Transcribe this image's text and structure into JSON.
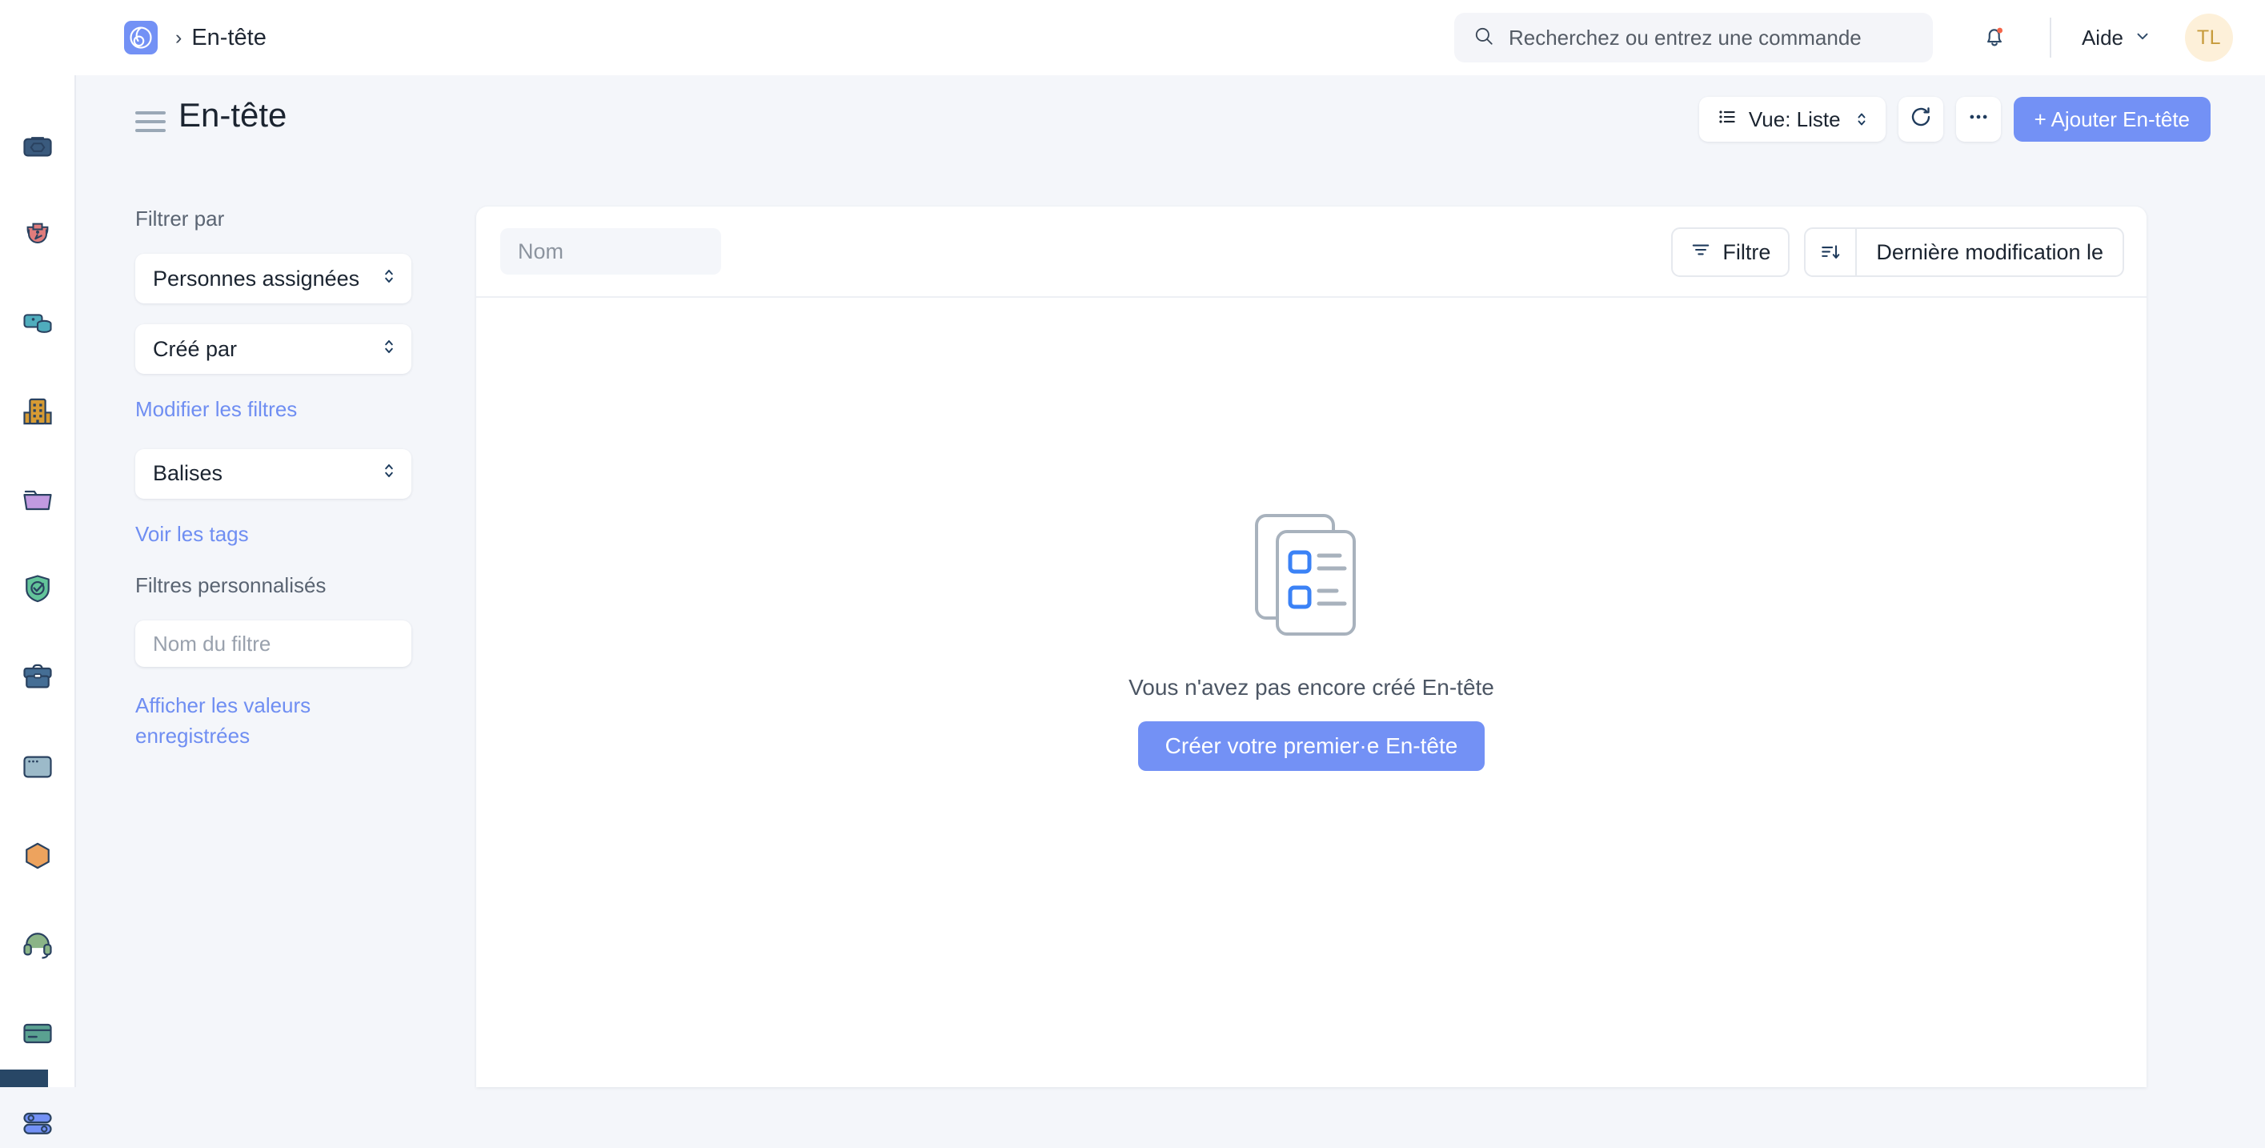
{
  "topbar": {
    "logo_icon": "app-logo-icon",
    "breadcrumb_separator": "›",
    "breadcrumb_label": "En-tête",
    "search": {
      "icon": "search-icon",
      "placeholder": "Recherchez ou entrez une commande",
      "value": ""
    },
    "notifications_icon": "bell-icon",
    "has_notification_dot": true,
    "help_label": "Aide",
    "help_chevron_icon": "chevron-down-icon",
    "avatar_initials": "TL"
  },
  "rail": {
    "items": [
      {
        "name": "briefcase-dark-icon",
        "color": "#3a5a7d"
      },
      {
        "name": "recruitment-icon",
        "color": "#e07c7c"
      },
      {
        "name": "data-storage-icon",
        "color": "#4fadbd"
      },
      {
        "name": "company-building-icon",
        "color": "#d79b33"
      },
      {
        "name": "folder-icon",
        "color": "#c19ae0"
      },
      {
        "name": "shield-check-icon",
        "color": "#63c49a"
      },
      {
        "name": "toolbox-icon",
        "color": "#456e95"
      },
      {
        "name": "window-icon",
        "color": "#9cbac9"
      },
      {
        "name": "hexagon-icon",
        "color": "#eda35e"
      },
      {
        "name": "headset-support-icon",
        "color": "#8bb487"
      },
      {
        "name": "card-icon",
        "color": "#5aa191"
      },
      {
        "name": "toggles-icon",
        "color": "#7391f5"
      }
    ]
  },
  "page": {
    "menu_icon": "hamburger-menu-icon",
    "title": "En-tête",
    "actions": {
      "view_icon": "list-view-icon",
      "view_label": "Vue: Liste",
      "refresh_icon": "refresh-icon",
      "more_icon": "more-options-icon",
      "add_label": "+ Ajouter En-tête"
    }
  },
  "filters": {
    "heading": "Filtrer par",
    "selects": [
      {
        "label": "Personnes assignées",
        "name": "filter-assignees"
      },
      {
        "label": "Créé par",
        "name": "filter-created-by"
      }
    ],
    "edit_filters_link": "Modifier les filtres",
    "tags_select": {
      "label": "Balises",
      "name": "filter-tags"
    },
    "view_tags_link": "Voir les tags",
    "custom_heading": "Filtres personnalisés",
    "filter_name_placeholder": "Nom du filtre",
    "filter_name_value": "",
    "saved_values_link": "Afficher les valeurs enregistrées"
  },
  "content": {
    "name_search_placeholder": "Nom",
    "name_search_value": "",
    "filter_button": {
      "icon": "filter-icon",
      "label": "Filtre"
    },
    "sort_button": {
      "icon": "sort-descending-icon",
      "label": "Dernière modification le"
    },
    "empty": {
      "illustration": "empty-documents-icon",
      "message": "Vous n'avez pas encore créé En-tête",
      "cta_label": "Créer votre premier·e En-tête"
    }
  },
  "colors": {
    "accent": "#7391f5",
    "link": "#6f8ef2",
    "page_bg": "#f4f6fa",
    "card_bg": "#ffffff",
    "text_dark": "#1b2430",
    "text_muted": "#5a6472",
    "avatar_bg": "#fdf0d9",
    "avatar_fg": "#c79b3b",
    "notification_dot": "#f4664a"
  }
}
